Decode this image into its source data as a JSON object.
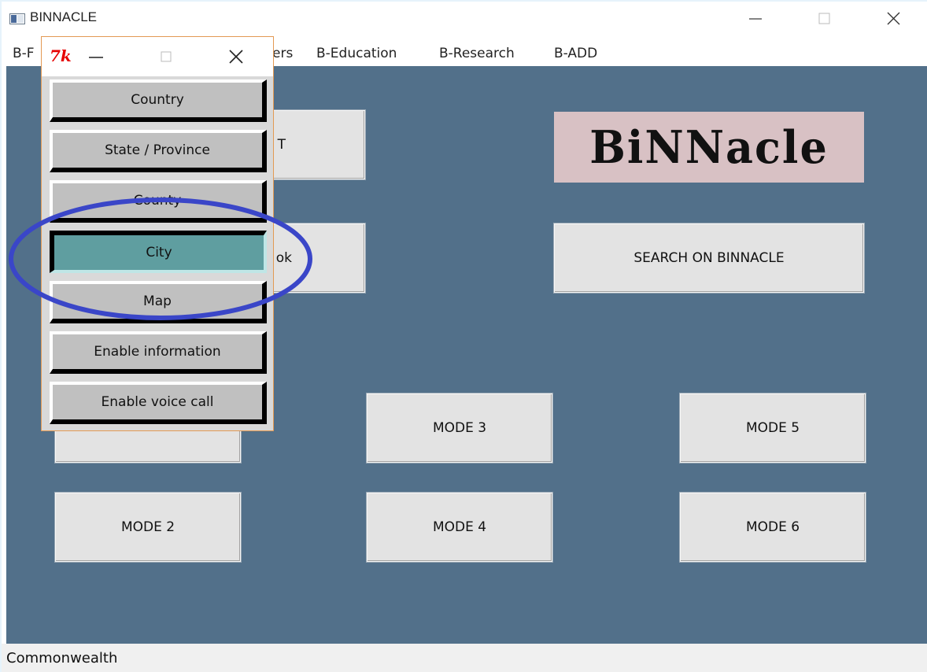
{
  "app": {
    "title": "BINNACLE"
  },
  "menu": {
    "items": [
      "B-F",
      "ers",
      "B-Education",
      "B-Research",
      "B-ADD"
    ]
  },
  "main": {
    "logo_text": "BiNNacle",
    "buttons": {
      "partial_top": "T",
      "partial_mid": "ok",
      "search": "SEARCH ON BINNACLE",
      "mode2": "MODE 2",
      "mode3": "MODE 3",
      "mode4": "MODE 4",
      "mode5": "MODE 5",
      "mode6": "MODE 6"
    }
  },
  "popup": {
    "icon_label": "Tk",
    "buttons": [
      {
        "label": "Country"
      },
      {
        "label": "State / Province"
      },
      {
        "label": "County"
      },
      {
        "label": "City"
      },
      {
        "label": "Map"
      },
      {
        "label": "Enable information"
      },
      {
        "label": "Enable voice call"
      }
    ]
  },
  "status": {
    "text": "Commonwealth"
  },
  "colors": {
    "canvas": "#52708a",
    "active_button": "#5f9ea0",
    "highlight_ellipse": "#3a46c8",
    "logo_bg": "#d8c1c4"
  }
}
